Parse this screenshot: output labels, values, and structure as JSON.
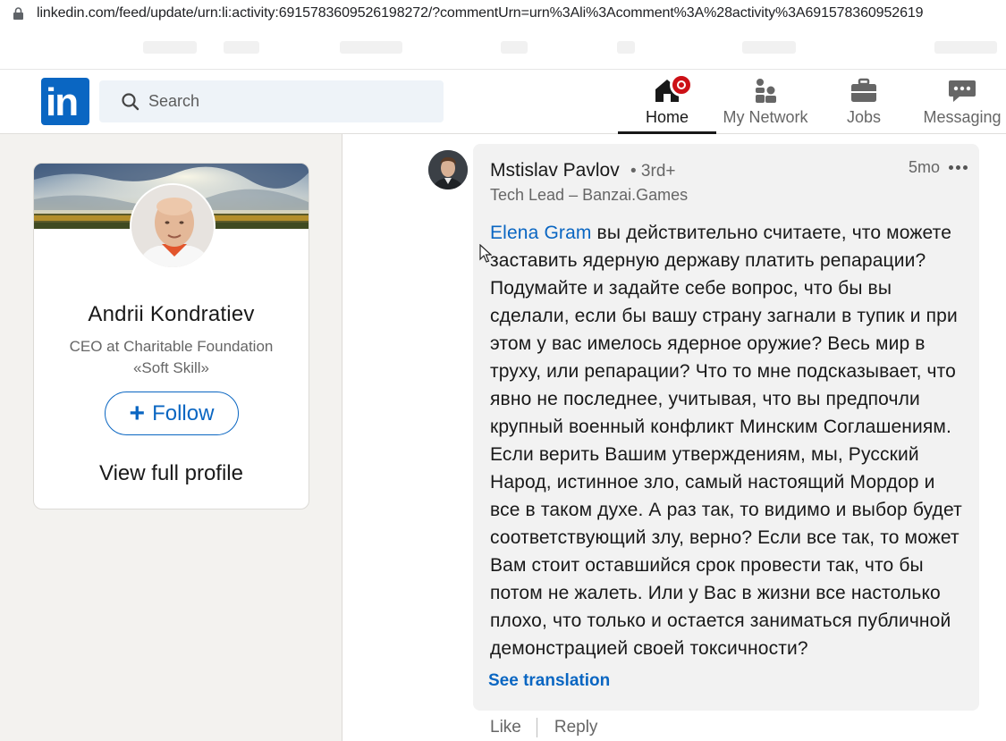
{
  "browser": {
    "url": "linkedin.com/feed/update/urn:li:activity:6915783609526198272/?commentUrn=urn%3Ali%3Acomment%3A%28activity%3A691578360952619"
  },
  "header": {
    "logo_text": "in",
    "search_placeholder": "Search",
    "nav": [
      {
        "label": "Home"
      },
      {
        "label": "My Network"
      },
      {
        "label": "Jobs"
      },
      {
        "label": "Messaging"
      }
    ]
  },
  "profile_card": {
    "name": "Andrii Kondratiev",
    "headline": "CEO at Charitable Foundation «Soft Skill»",
    "follow_label": "Follow",
    "follow_plus": "+",
    "view_profile_label": "View full profile"
  },
  "comment": {
    "author": "Mstislav Pavlov",
    "degree": "• 3rd+",
    "author_headline": "Tech Lead – Banzai.Games",
    "time_ago": "5mo",
    "mention": "Elena Gram",
    "body": " вы действительно считаете, что можете заставить ядерную державу платить репарации? Подумайте и задайте себе вопрос, что бы вы сделали, если бы вашу страну загнали в тупик и при этом у вас имелось ядерное оружие? Весь мир в труху, или репарации? Что то мне подсказывает, что явно не последнее, учитывая, что вы предпочли крупный военный конфликт Минским Соглашениям. Если верить Вашим утверждениям, мы, Русский Народ, истинное зло, самый настоящий Мордор и все в таком духе. А раз так, то видимо и выбор будет соответствующий злу, верно? Если все так, то может Вам стоит оставшийся срок провести так, что бы потом не жалеть. Или у Вас в жизни все настолько плохо, что только и остается заниматься публичной демонстрацией своей токсичности?",
    "see_translation": "See translation",
    "like_label": "Like",
    "reply_label": "Reply"
  },
  "colors": {
    "brand": "#0a66c2",
    "notification": "#cc1016",
    "bubble": "#f2f2f2",
    "page_bg": "#f3f2ef"
  }
}
